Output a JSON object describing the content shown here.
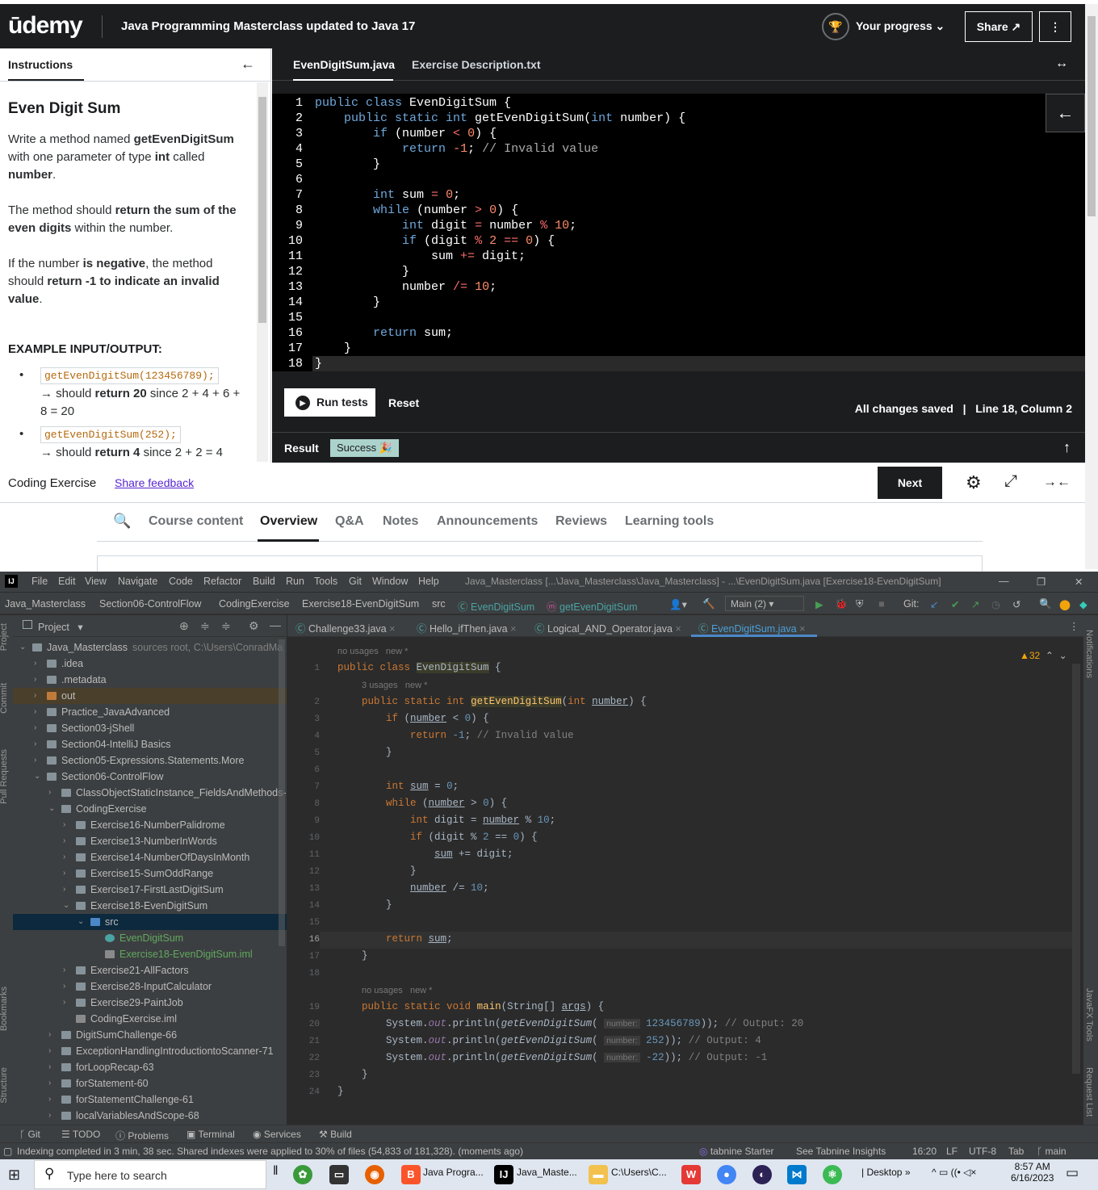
{
  "udemy": {
    "logo": "ūdemy",
    "course_title": "Java Programming Masterclass updated to Java 17",
    "progress_label": "Your progress",
    "share_label": "Share",
    "more_label": "⋮"
  },
  "instructions": {
    "tab_label": "Instructions",
    "heading": "Even Digit Sum",
    "p1_a": "Write a method named ",
    "p1_b": "getEvenDigitSum",
    "p1_c": " with one parameter of type ",
    "p1_d": "int",
    "p1_e": " called ",
    "p1_f": "number",
    "p2_a": "The method should ",
    "p2_b": "return the sum of the even digits",
    "p2_c": " within the number.",
    "p3_a": "If the number ",
    "p3_b": "is negative",
    "p3_c": ", the method should ",
    "p3_d": "return -1 to indicate an invalid value",
    "example_heading": "EXAMPLE INPUT/OUTPUT:",
    "ex1_code": "getEvenDigitSum(123456789);",
    "ex1_a": "→ should ",
    "ex1_b": "return 20",
    "ex1_c": " since 2 + 4 + 6 + 8 = 20",
    "ex2_code": "getEvenDigitSum(252);",
    "ex2_a": "→ should ",
    "ex2_b": "return 4",
    "ex2_c": " since 2 + 2 = 4"
  },
  "editor": {
    "tab1": "EvenDigitSum.java",
    "tab2": "Exercise Description.txt",
    "run_label": "Run tests",
    "reset_label": "Reset",
    "saved": "All changes saved",
    "position": "Line 18, Column 2",
    "result_label": "Result",
    "result_badge": "Success 🎉"
  },
  "bar2": {
    "coding_exercise": "Coding Exercise",
    "share_feedback": "Share feedback",
    "next_label": "Next"
  },
  "course_nav": {
    "tabs": [
      "Course content",
      "Overview",
      "Q&A",
      "Notes",
      "Announcements",
      "Reviews",
      "Learning tools"
    ],
    "active": "Overview"
  },
  "ij": {
    "menu": [
      "File",
      "Edit",
      "View",
      "Navigate",
      "Code",
      "Refactor",
      "Build",
      "Run",
      "Tools",
      "Git",
      "Window",
      "Help"
    ],
    "window_title": "Java_Masterclass [...\\Java_Masterclass\\Java_Masterclass] - ...\\EvenDigitSum.java [Exercise18-EvenDigitSum]",
    "breadcrumbs": [
      "Java_Masterclass",
      "Section06-ControlFlow",
      "CodingExercise",
      "Exercise18-EvenDigitSum",
      "src",
      "EvenDigitSum",
      "getEvenDigitSum"
    ],
    "run_config": "Main (2)",
    "git_label": "Git:",
    "project_label": "Project",
    "tree": [
      {
        "label": "Java_Masterclass",
        "extra": "sources root, C:\\Users\\ConradMa"
      },
      {
        "label": ".idea"
      },
      {
        "label": ".metadata"
      },
      {
        "label": "out"
      },
      {
        "label": "Practice_JavaAdvanced"
      },
      {
        "label": "Section03-jShell"
      },
      {
        "label": "Section04-IntelliJ Basics"
      },
      {
        "label": "Section05-Expressions.Statements.More"
      },
      {
        "label": "Section06-ControlFlow"
      },
      {
        "label": "ClassObjectStaticInstance_FieldsAndMethods-"
      },
      {
        "label": "CodingExercise"
      },
      {
        "label": "Exercise16-NumberPalidrome"
      },
      {
        "label": "Exercise13-NumberInWords"
      },
      {
        "label": "Exercise14-NumberOfDaysInMonth"
      },
      {
        "label": "Exercise15-SumOddRange"
      },
      {
        "label": "Exercise17-FirstLastDigitSum"
      },
      {
        "label": "Exercise18-EvenDigitSum"
      },
      {
        "label": "src"
      },
      {
        "label": "EvenDigitSum"
      },
      {
        "label": "Exercise18-EvenDigitSum.iml"
      },
      {
        "label": "Exercise21-AllFactors"
      },
      {
        "label": "Exercise28-InputCalculator"
      },
      {
        "label": "Exercise29-PaintJob"
      },
      {
        "label": "CodingExercise.iml"
      },
      {
        "label": "DigitSumChallenge-66"
      },
      {
        "label": "ExceptionHandlingIntroductiontoScanner-71"
      },
      {
        "label": "forLoopRecap-63"
      },
      {
        "label": "forStatement-60"
      },
      {
        "label": "forStatementChallenge-61"
      },
      {
        "label": "localVariablesAndScope-68"
      }
    ],
    "editor_tabs": [
      "Challenge33.java",
      "Hello_ifThen.java",
      "Logical_AND_Operator.java",
      "EvenDigitSum.java"
    ],
    "warnings": "▲32",
    "bottom_tools": [
      "Git",
      "TODO",
      "Problems",
      "Terminal",
      "Services",
      "Build"
    ],
    "status": "Indexing completed in 3 min, 38 sec. Shared indexes were applied to 30% of files (54,833 of 181,328). (moments ago)",
    "tabnine": "tabnine Starter",
    "tabnine_insights": "See Tabnine Insights",
    "pos": "16:20",
    "lf": "LF",
    "enc": "UTF-8",
    "indent": "Tab",
    "branch": "main",
    "side_left": [
      "Project",
      "Commit",
      "Pull Requests",
      "Bookmarks",
      "Structure"
    ],
    "side_right": [
      "Notifications",
      "JavaFX Tools",
      "Request List"
    ]
  },
  "taskbar": {
    "search_placeholder": "Type here to search",
    "items": [
      "Java Progra...",
      "Java_Maste...",
      "C:\\Users\\C..."
    ],
    "desktop": "Desktop",
    "time": "8:57 AM",
    "date": "6/16/2023"
  },
  "colors": {
    "udemy_dark": "#1c1d1f",
    "udemy_purple": "#5624d0",
    "ij_bg": "#2b2b2b",
    "ij_panel": "#3c3f41"
  }
}
